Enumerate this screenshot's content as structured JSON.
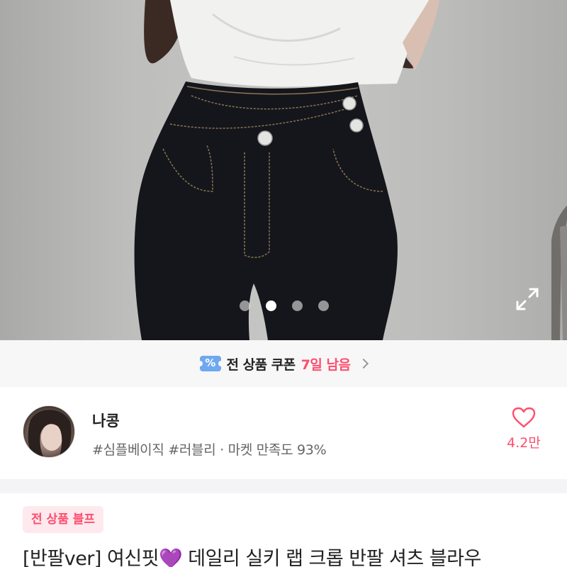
{
  "gallery": {
    "slide_count": 4,
    "active_slide": 2,
    "expand_icon": "expand-icon"
  },
  "coupon_banner": {
    "icon": "coupon-icon",
    "icon_text": "%",
    "text": "전 상품 쿠폰",
    "highlight": "7일 남음",
    "highlight_color": "#ff4d6d"
  },
  "seller": {
    "name": "나콩",
    "tags": "#심플베이직 #러블리 · 마켓 만족도 93%",
    "like_count": "4.2만",
    "heart_icon": "heart-icon"
  },
  "product": {
    "badge": "전 상품 블프",
    "title": "[반팔ver] 여신핏💜 데일리 실키 랩 크롭 반팔 셔츠 블라우"
  },
  "colors": {
    "accent": "#ff4d6d",
    "banner_bg": "#f7f7f8",
    "coupon_icon": "#6fa8ef"
  }
}
